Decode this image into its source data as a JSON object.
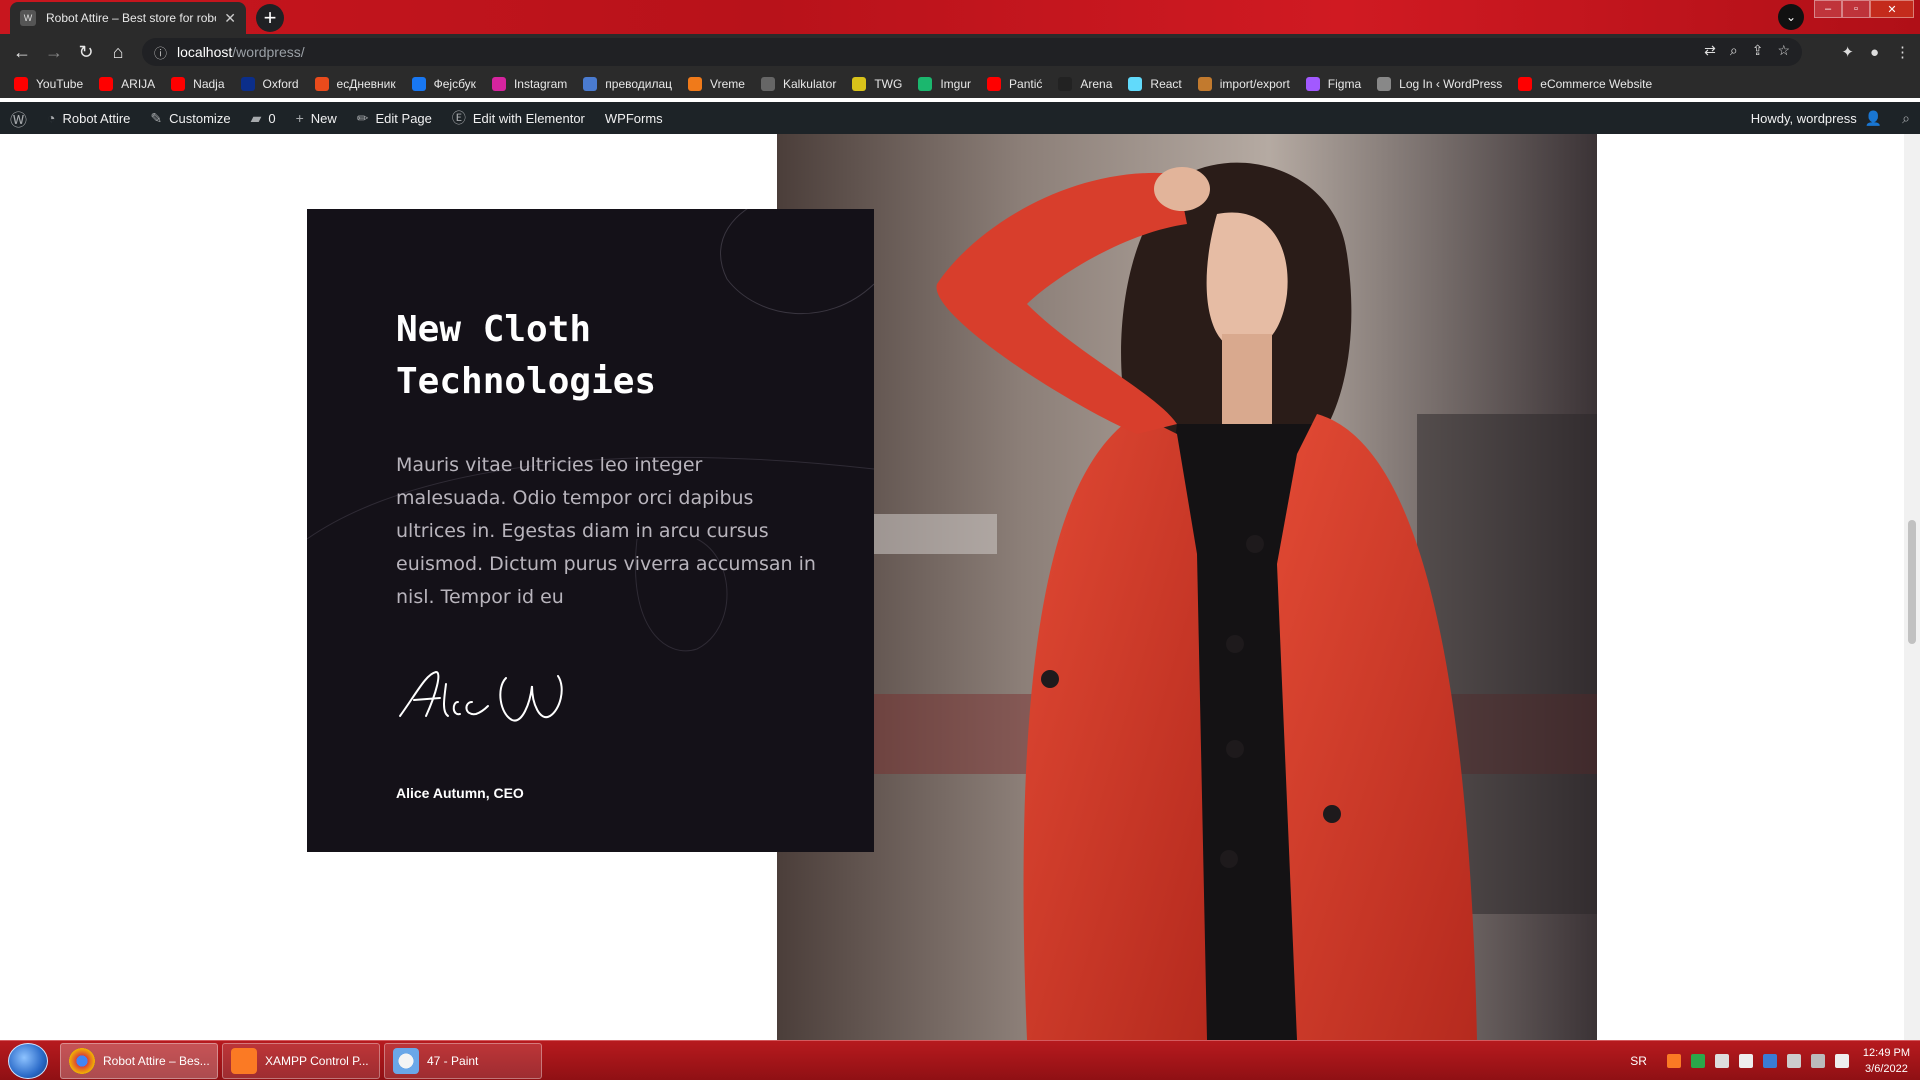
{
  "browser": {
    "tab_title": "Robot Attire – Best store for robo",
    "url_host": "localhost",
    "url_path": "/wordpress/"
  },
  "bookmarks": [
    {
      "label": "YouTube",
      "icon": "youtube-icon",
      "color": "#ff0000"
    },
    {
      "label": "ARIJA",
      "icon": "youtube-icon",
      "color": "#ff0000"
    },
    {
      "label": "Nadja",
      "icon": "youtube-icon",
      "color": "#ff0000"
    },
    {
      "label": "Oxford",
      "icon": "oup-icon",
      "color": "#0b2e8a"
    },
    {
      "label": "есДневник",
      "icon": "esdnevnik-icon",
      "color": "#e94b1c"
    },
    {
      "label": "Фејсбук",
      "icon": "facebook-icon",
      "color": "#1877f2"
    },
    {
      "label": "Instagram",
      "icon": "instagram-icon",
      "color": "#d6249f"
    },
    {
      "label": "преводилац",
      "icon": "translate-icon",
      "color": "#4a7bd0"
    },
    {
      "label": "Vreme",
      "icon": "weather-icon",
      "color": "#f07a1a"
    },
    {
      "label": "Kalkulator",
      "icon": "calculator-icon",
      "color": "#666666"
    },
    {
      "label": "TWG",
      "icon": "twg-icon",
      "color": "#d8c21a"
    },
    {
      "label": "Imgur",
      "icon": "imgur-icon",
      "color": "#1bb76e"
    },
    {
      "label": "Pantić",
      "icon": "youtube-icon",
      "color": "#ff0000"
    },
    {
      "label": "Arena",
      "icon": "arena-icon",
      "color": "#222222"
    },
    {
      "label": "React",
      "icon": "react-icon",
      "color": "#61dafb"
    },
    {
      "label": "import/export",
      "icon": "import-icon",
      "color": "#c27a2e"
    },
    {
      "label": "Figma",
      "icon": "figma-icon",
      "color": "#a259ff"
    },
    {
      "label": "Log In ‹ WordPress",
      "icon": "page-icon",
      "color": "#888888"
    },
    {
      "label": "eCommerce Website",
      "icon": "youtube-icon",
      "color": "#ff0000"
    }
  ],
  "adminbar": {
    "site": "Robot Attire",
    "customize": "Customize",
    "comments": "0",
    "new": "New",
    "edit_page": "Edit Page",
    "elementor": "Edit with Elementor",
    "wpforms": "WPForms",
    "howdy": "Howdy, wordpress"
  },
  "hero": {
    "title": "New Cloth Technologies",
    "body": "Mauris vitae ultricies leo integer malesuada. Odio tempor orci dapibus ultrices in. Egestas diam in arcu cursus euismod. Dictum purus viverra accumsan in nisl. Tempor id eu",
    "signature": "Alice W",
    "author": "Alice Autumn, CEO"
  },
  "taskbar": {
    "items": [
      {
        "label": "Robot Attire – Bes...",
        "icon": "chrome-icon"
      },
      {
        "label": "XAMPP Control P...",
        "icon": "xampp-icon"
      },
      {
        "label": "47 - Paint",
        "icon": "paint-icon"
      }
    ],
    "lang": "SR",
    "time": "12:49 PM",
    "date": "3/6/2022"
  }
}
